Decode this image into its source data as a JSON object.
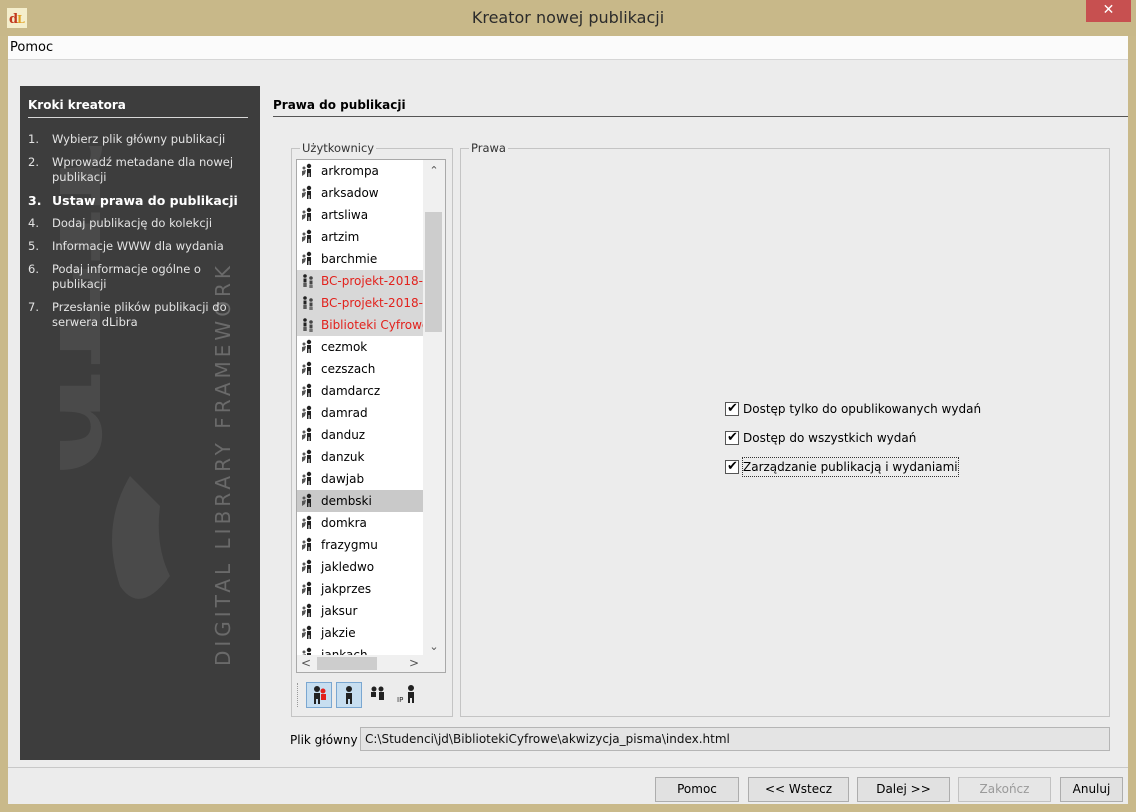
{
  "window": {
    "title": "Kreator nowej publikacji",
    "close_glyph": "✕"
  },
  "menu": {
    "items": [
      "Pomoc"
    ]
  },
  "sidebar": {
    "heading": "Kroki kreatora",
    "watermark_text": "DIGITAL LIBRARY FRAMEWORK",
    "steps": [
      {
        "num": "1.",
        "label": "Wybierz plik główny publikacji",
        "active": false
      },
      {
        "num": "2.",
        "label": "Wprowadź metadane dla nowej publikacji",
        "active": false
      },
      {
        "num": "3.",
        "label": "Ustaw prawa do publikacji",
        "active": true
      },
      {
        "num": "4.",
        "label": "Dodaj publikację do kolekcji",
        "active": false
      },
      {
        "num": "5.",
        "label": "Informacje WWW dla wydania",
        "active": false
      },
      {
        "num": "6.",
        "label": "Podaj informacje ogólne o publikacji",
        "active": false
      },
      {
        "num": "7.",
        "label": "Przesłanie plików publikacji do serwera dLibra",
        "active": false
      }
    ]
  },
  "main": {
    "section_title": "Prawa do publikacji",
    "users_label": "Użytkownicy",
    "rights_label": "Prawa",
    "users": [
      {
        "name": "arkrompa",
        "kind": "user"
      },
      {
        "name": "arksadow",
        "kind": "user"
      },
      {
        "name": "artsliwa",
        "kind": "user"
      },
      {
        "name": "artzim",
        "kind": "user"
      },
      {
        "name": "barchmie",
        "kind": "user"
      },
      {
        "name": "BC-projekt-2018-",
        "kind": "group"
      },
      {
        "name": "BC-projekt-2018-",
        "kind": "group"
      },
      {
        "name": "Biblioteki Cyfrowe",
        "kind": "group"
      },
      {
        "name": "cezmok",
        "kind": "user"
      },
      {
        "name": "cezszach",
        "kind": "user"
      },
      {
        "name": "damdarcz",
        "kind": "user"
      },
      {
        "name": "damrad",
        "kind": "user"
      },
      {
        "name": "danduz",
        "kind": "user"
      },
      {
        "name": "danzuk",
        "kind": "user"
      },
      {
        "name": "dawjab",
        "kind": "user"
      },
      {
        "name": "dembski",
        "kind": "selected"
      },
      {
        "name": "domkra",
        "kind": "user"
      },
      {
        "name": "frazygmu",
        "kind": "user"
      },
      {
        "name": "jakledwo",
        "kind": "user"
      },
      {
        "name": "jakprzes",
        "kind": "user"
      },
      {
        "name": "jaksur",
        "kind": "user"
      },
      {
        "name": "jakzie",
        "kind": "user"
      },
      {
        "name": "jankach",
        "kind": "user"
      }
    ],
    "rights": [
      {
        "label": "Dostęp tylko do opublikowanych wydań",
        "checked": true,
        "focused": false
      },
      {
        "label": "Dostęp do wszystkich wydań",
        "checked": true,
        "focused": false
      },
      {
        "label": "Zarządzanie publikacją i wydaniami",
        "checked": true,
        "focused": true
      }
    ],
    "main_file_label": "Plik główny",
    "main_file_value": "C:\\Studenci\\jd\\BibliotekiCyfrowe\\akwizycja_pisma\\index.html"
  },
  "buttons": {
    "help": "Pomoc",
    "back": "<< Wstecz",
    "next": "Dalej >>",
    "finish": "Zakończ",
    "cancel": "Anuluj"
  },
  "colors": {
    "group_text": "#e2211c",
    "sidebar_bg": "#3d3d3d",
    "title_bar": "#c8b889",
    "close_button": "#c75050"
  }
}
